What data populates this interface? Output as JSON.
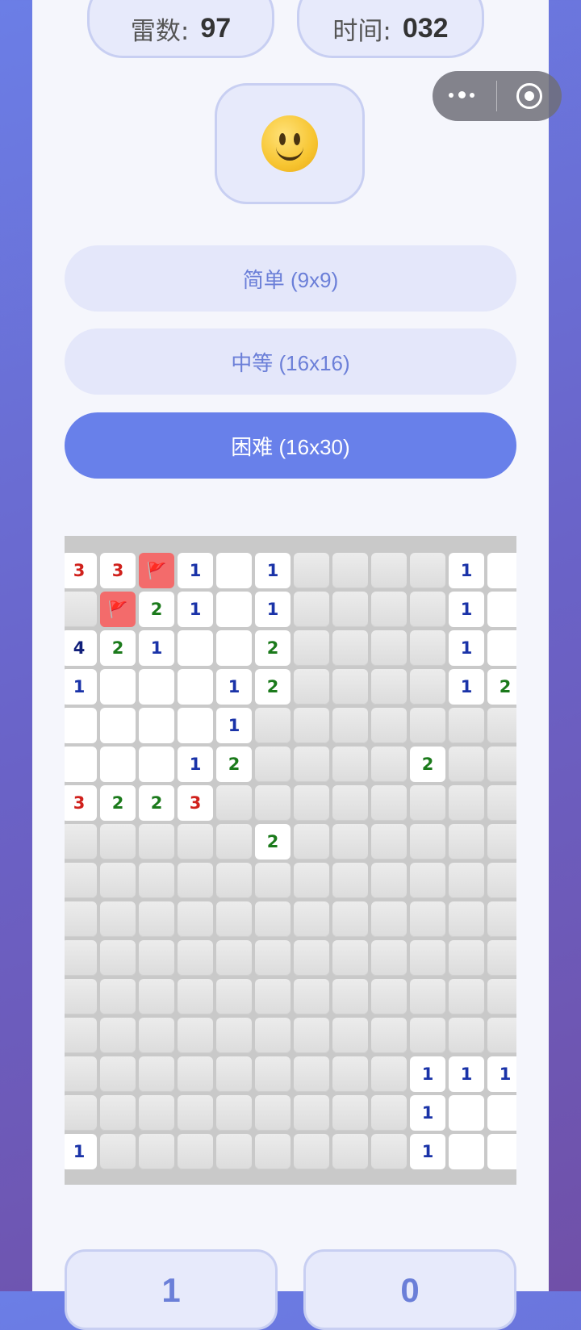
{
  "header": {
    "mine_label": "雷数:",
    "mine_count": "97",
    "time_label": "时间:",
    "time_value": "032",
    "face_icon": "slightly-smiling-face"
  },
  "difficulty": {
    "options": [
      {
        "label": "简单 (9x9)",
        "selected": false
      },
      {
        "label": "中等 (16x16)",
        "selected": false
      },
      {
        "label": "困难 (16x30)",
        "selected": true
      }
    ]
  },
  "board": {
    "visible_rows": [
      [
        "3",
        "3",
        "F",
        "1",
        "0",
        "1",
        "H",
        "H",
        "H",
        "H",
        "1",
        "0"
      ],
      [
        "H",
        "F",
        "2",
        "1",
        "0",
        "1",
        "H",
        "H",
        "H",
        "H",
        "1",
        "0"
      ],
      [
        "4",
        "2",
        "1",
        "0",
        "0",
        "2",
        "H",
        "H",
        "H",
        "H",
        "1",
        "0"
      ],
      [
        "1",
        "0",
        "0",
        "0",
        "1",
        "2",
        "H",
        "H",
        "H",
        "H",
        "1",
        "2"
      ],
      [
        "0",
        "0",
        "0",
        "0",
        "1",
        "H",
        "H",
        "H",
        "H",
        "H",
        "H",
        "H"
      ],
      [
        "0",
        "0",
        "0",
        "1",
        "2",
        "H",
        "H",
        "H",
        "H",
        "2",
        "H",
        "H"
      ],
      [
        "3",
        "2",
        "2",
        "3",
        "H",
        "H",
        "H",
        "H",
        "H",
        "H",
        "H",
        "H"
      ],
      [
        "H",
        "H",
        "H",
        "H",
        "H",
        "2",
        "H",
        "H",
        "H",
        "H",
        "H",
        "H"
      ],
      [
        "H",
        "H",
        "H",
        "H",
        "H",
        "H",
        "H",
        "H",
        "H",
        "H",
        "H",
        "H"
      ],
      [
        "H",
        "H",
        "H",
        "H",
        "H",
        "H",
        "H",
        "H",
        "H",
        "H",
        "H",
        "H"
      ],
      [
        "H",
        "H",
        "H",
        "H",
        "H",
        "H",
        "H",
        "H",
        "H",
        "H",
        "H",
        "H"
      ],
      [
        "H",
        "H",
        "H",
        "H",
        "H",
        "H",
        "H",
        "H",
        "H",
        "H",
        "H",
        "H"
      ],
      [
        "H",
        "H",
        "H",
        "H",
        "H",
        "H",
        "H",
        "H",
        "H",
        "H",
        "H",
        "H"
      ],
      [
        "H",
        "H",
        "H",
        "H",
        "H",
        "H",
        "H",
        "H",
        "H",
        "1",
        "1",
        "1"
      ],
      [
        "H",
        "H",
        "H",
        "H",
        "H",
        "H",
        "H",
        "H",
        "H",
        "1",
        "0",
        "0"
      ],
      [
        "1",
        "H",
        "H",
        "H",
        "H",
        "H",
        "H",
        "H",
        "H",
        "1",
        "0",
        "0"
      ]
    ],
    "flag_icon": "red-flag"
  },
  "bottom_buttons": [
    {
      "text": "1"
    },
    {
      "text": "0"
    }
  ],
  "capsule": {
    "more_icon": "more-dots-icon",
    "close_icon": "target-circle-icon"
  }
}
